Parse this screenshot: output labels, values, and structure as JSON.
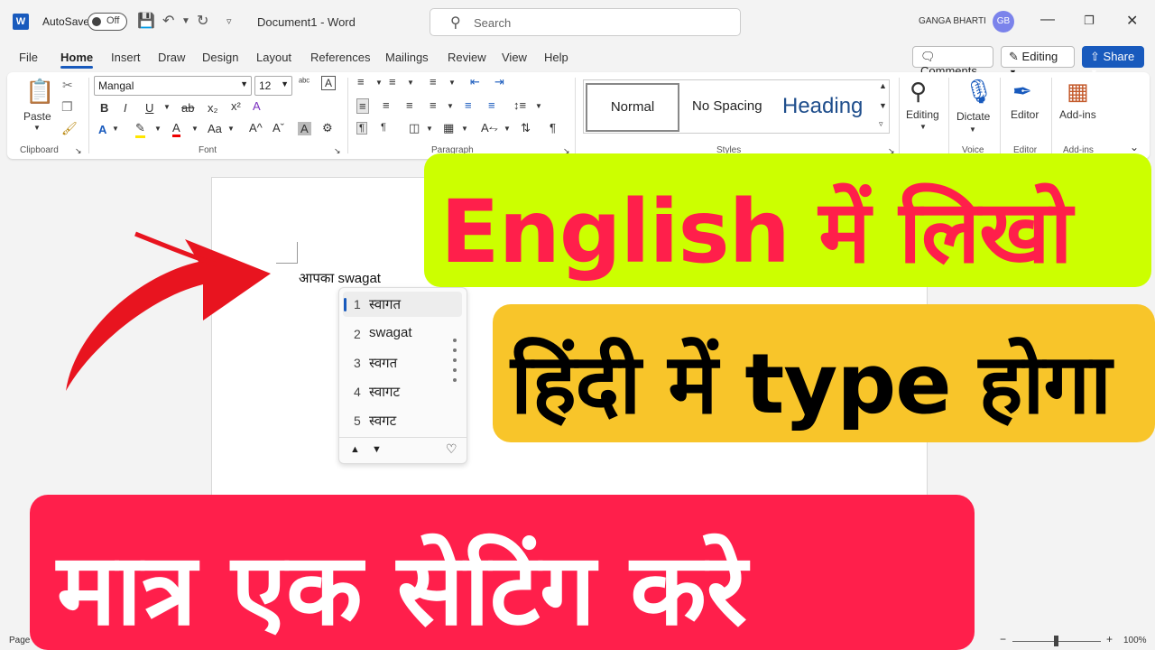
{
  "titlebar": {
    "app_logo": "W",
    "autosave_label": "AutoSave",
    "autosave_state": "Off",
    "document_title": "Document1 - Word",
    "search_placeholder": "Search",
    "user_name": "GANGA BHARTI",
    "user_initials": "GB"
  },
  "menu": {
    "tabs": [
      "File",
      "Home",
      "Insert",
      "Draw",
      "Design",
      "Layout",
      "References",
      "Mailings",
      "Review",
      "View",
      "Help"
    ],
    "active_tab": "Home",
    "comments": "Comments",
    "editing": "Editing",
    "share": "Share"
  },
  "ribbon": {
    "clipboard": {
      "paste": "Paste",
      "label": "Clipboard"
    },
    "font": {
      "name": "Mangal",
      "size": "12",
      "label": "Font"
    },
    "paragraph": {
      "label": "Paragraph"
    },
    "styles": {
      "normal": "Normal",
      "no_spacing": "No Spacing",
      "heading": "Heading",
      "label": "Styles"
    },
    "editing": {
      "label": "Editing"
    },
    "dictate": {
      "label": "Dictate",
      "group": "Voice"
    },
    "editor": {
      "label": "Editor",
      "group": "Editor"
    },
    "addins": {
      "label": "Add-ins",
      "group": "Add-ins"
    }
  },
  "document": {
    "typed_hindi": "आपका",
    "typed_english": "swagat"
  },
  "ime": {
    "candidates": [
      {
        "num": "1",
        "word": "स्वागत"
      },
      {
        "num": "2",
        "word": "swagat"
      },
      {
        "num": "3",
        "word": "स्वगत"
      },
      {
        "num": "4",
        "word": "स्वागट"
      },
      {
        "num": "5",
        "word": "स्वगट"
      }
    ],
    "selected_index": 0
  },
  "banners": {
    "line1": "English में लिखो",
    "line2": "हिंदी में type होगा",
    "line3": "मात्र एक सेटिंग करे"
  },
  "statusbar": {
    "page": "Page",
    "zoom": "100%"
  },
  "colors": {
    "accent": "#185abd",
    "banner1_bg": "#ccff00",
    "banner1_text": "#ff1f4b",
    "banner2_bg": "#f8c52a",
    "banner3_bg": "#ff1f4b",
    "arrow": "#e8141f"
  }
}
